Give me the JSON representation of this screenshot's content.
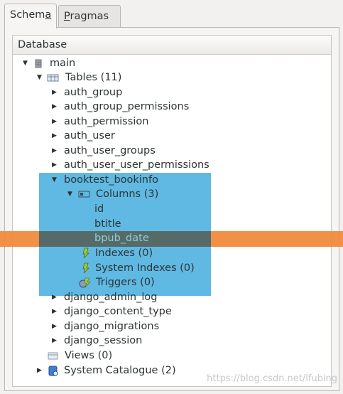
{
  "tabs": {
    "schema": "Schema",
    "pragmas": "Pragmas"
  },
  "tree": {
    "header": "Database",
    "main": "main",
    "tables": "Tables (11)",
    "items": [
      "auth_group",
      "auth_group_permissions",
      "auth_permission",
      "auth_user",
      "auth_user_groups",
      "auth_user_user_permissions",
      "booktest_bookinfo"
    ],
    "columns": "Columns (3)",
    "col_id": "id",
    "col_btitle": "btitle",
    "col_bpub_date": "bpub_date",
    "indexes": "Indexes (0)",
    "system_indexes": "System Indexes (0)",
    "triggers": "Triggers (0)",
    "items2": [
      "django_admin_log",
      "django_content_type",
      "django_migrations",
      "django_session"
    ],
    "views": "Views (0)",
    "system_catalogue": "System Catalogue (2)"
  },
  "watermark": "https://blog.csdn.net/lfubing",
  "colors": {
    "highlight_orange": "#f08a3c",
    "highlight_blue": "#3caadc"
  }
}
